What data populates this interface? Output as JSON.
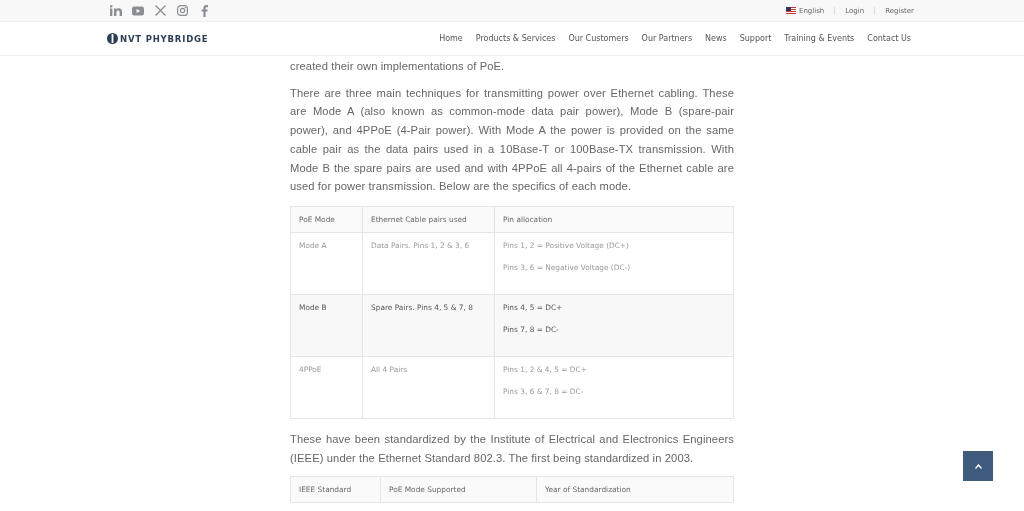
{
  "top_bar": {
    "language": "English",
    "links": [
      "Login",
      "Register"
    ]
  },
  "header": {
    "logo": "NVT PHYBRIDGE",
    "nav": [
      "Home",
      "Products & Services",
      "Our Customers",
      "Our Partners",
      "News",
      "Support",
      "Training & Events",
      "Contact Us"
    ]
  },
  "paragraphs": [
    "created their own implementations of PoE.",
    "There are three main techniques for transmitting power over Ethernet cabling. These are Mode A (also known as common-mode data pair power), Mode B (spare-pair power), and 4PPoE (4-Pair power). With Mode A the power is provided on the same cable pair as the data pairs used in a 10Base-T or 100Base-TX transmission. With Mode B the spare pairs are used and with 4PPoE all 4-pairs of the Ethernet cable are used for power transmission. Below are the specifics of each mode."
  ],
  "modes_table": {
    "columns": [
      "PoE Mode",
      "Ethernet Cable pairs used",
      "Pin allocation"
    ],
    "rows": [
      {
        "mode": "Mode A",
        "pairs": "Data Pairs. Pins 1, 2 & 3, 6",
        "pins": [
          "Pins 1, 2 = Positive Voltage (DC+)",
          "Pins 3, 6 = Negative Voltage (DC-)"
        ],
        "highlighted": false
      },
      {
        "mode": "Mode B",
        "pairs": "Spare Pairs. Pins 4, 5 & 7, 8",
        "pins": [
          "Pins 4, 5 = DC+",
          "Pins 7, 8 = DC-"
        ],
        "highlighted": true
      },
      {
        "mode": "4PPoE",
        "pairs": "All 4 Pairs",
        "pins": [
          "Pins 1, 2 & 4, 5 = DC+",
          "Pins 3, 6 & 7, 8 = DC-"
        ],
        "highlighted": false
      }
    ]
  },
  "paragraph_after": "These have been standardized by the Institute of Electrical and Electronics Engineers (IEEE) under the Ethernet Standard 802.3. The first being standardized in 2003.",
  "standards_table": {
    "columns": [
      "IEEE Standard",
      "PoE Mode Supported",
      "Year of Standardization"
    ]
  }
}
